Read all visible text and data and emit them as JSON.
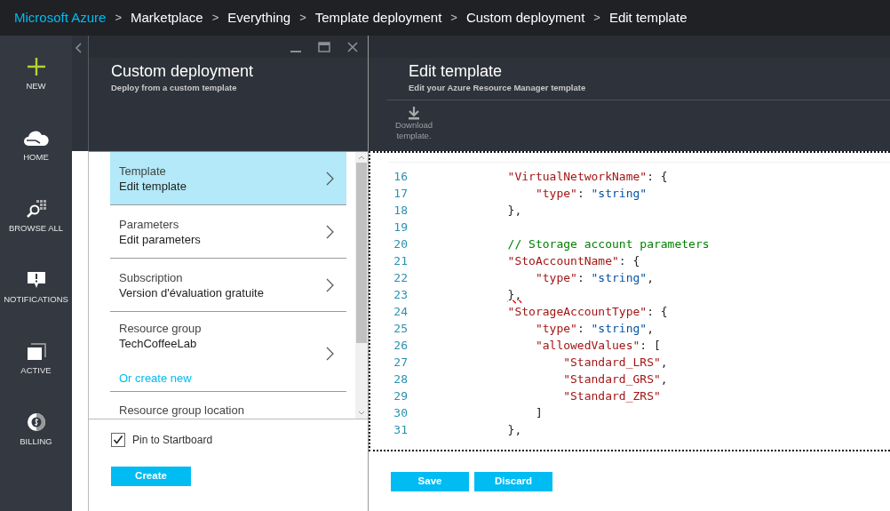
{
  "breadcrumb": {
    "brand": "Microsoft Azure",
    "items": [
      {
        "separator": ">",
        "label": "Marketplace"
      },
      {
        "separator": ">",
        "label": "Everything"
      },
      {
        "separator": ">",
        "label": "Template deployment"
      },
      {
        "separator": ">",
        "label": "Custom deployment"
      },
      {
        "separator": ">",
        "label": "Edit template"
      }
    ]
  },
  "nav": [
    {
      "label": "NEW"
    },
    {
      "label": "HOME"
    },
    {
      "label": "BROWSE ALL"
    },
    {
      "label": "NOTIFICATIONS"
    },
    {
      "label": "ACTIVE"
    },
    {
      "label": "BILLING"
    }
  ],
  "custom_deployment": {
    "title": "Custom deployment",
    "subtitle": "Deploy from a custom template",
    "items": [
      {
        "title": "Template",
        "value": "Edit template",
        "selected": true
      },
      {
        "title": "Parameters",
        "value": "Edit parameters",
        "selected": false
      },
      {
        "title": "Subscription",
        "value": "Version d'évaluation gratuite",
        "selected": false
      },
      {
        "title": "Resource group",
        "value": "TechCoffeeLab",
        "link": "Or create new",
        "selected": false
      },
      {
        "title": "Resource group location",
        "selected": false
      }
    ],
    "pin": {
      "label": "Pin to Startboard",
      "checked": true
    },
    "button": "Create"
  },
  "edit_template": {
    "title": "Edit template",
    "subtitle": "Edit your Azure Resource Manager template",
    "toolbar": [
      {
        "label": "Download template."
      }
    ],
    "code": [
      {
        "number": "16",
        "tokens": [
          {
            "kind": "key",
            "text": "\"VirtualNetworkName\""
          },
          {
            "kind": "punct",
            "text": ": {"
          }
        ]
      },
      {
        "number": "17",
        "tokens": [
          {
            "kind": "key",
            "text": "\"type\""
          },
          {
            "kind": "punct",
            "text": ": "
          },
          {
            "kind": "string",
            "text": "\"string\""
          }
        ]
      },
      {
        "number": "18",
        "tokens": [
          {
            "kind": "punct",
            "text": "},"
          }
        ]
      },
      {
        "number": "19"
      },
      {
        "number": "20",
        "tokens": [
          {
            "kind": "comment",
            "text": "// Storage account parameters"
          }
        ]
      },
      {
        "number": "21",
        "tokens": [
          {
            "kind": "key",
            "text": "\"StoAccountName\""
          },
          {
            "kind": "punct",
            "text": ": {"
          }
        ]
      },
      {
        "number": "22",
        "tokens": [
          {
            "kind": "key",
            "text": "\"type\""
          },
          {
            "kind": "punct",
            "text": ": "
          },
          {
            "kind": "string",
            "text": "\"string\""
          },
          {
            "kind": "punct",
            "text": ","
          }
        ]
      },
      {
        "number": "23",
        "tokens": [
          {
            "kind": "punct",
            "text": "},",
            "error": true
          }
        ]
      },
      {
        "number": "24",
        "tokens": [
          {
            "kind": "key",
            "text": "\"StorageAccountType\""
          },
          {
            "kind": "punct",
            "text": ": {"
          }
        ]
      },
      {
        "number": "25",
        "tokens": [
          {
            "kind": "key",
            "text": "\"type\""
          },
          {
            "kind": "punct",
            "text": ": "
          },
          {
            "kind": "string",
            "text": "\"string\""
          },
          {
            "kind": "punct",
            "text": ","
          }
        ]
      },
      {
        "number": "26",
        "tokens": [
          {
            "kind": "key",
            "text": "\"allowedValues\""
          },
          {
            "kind": "punct",
            "text": ": ["
          }
        ]
      },
      {
        "number": "27",
        "tokens": [
          {
            "kind": "key",
            "text": "\"Standard_LRS\""
          },
          {
            "kind": "punct",
            "text": ","
          }
        ]
      },
      {
        "number": "28",
        "tokens": [
          {
            "kind": "key",
            "text": "\"Standard_GRS\""
          },
          {
            "kind": "punct",
            "text": ","
          }
        ]
      },
      {
        "number": "29",
        "tokens": [
          {
            "kind": "key",
            "text": "\"Standard_ZRS\""
          }
        ]
      },
      {
        "number": "30",
        "tokens": [
          {
            "kind": "punct",
            "text": "]"
          }
        ]
      },
      {
        "number": "31",
        "tokens": [
          {
            "kind": "punct",
            "text": "},"
          }
        ]
      }
    ],
    "buttons": [
      "Save",
      "Discard"
    ]
  }
}
